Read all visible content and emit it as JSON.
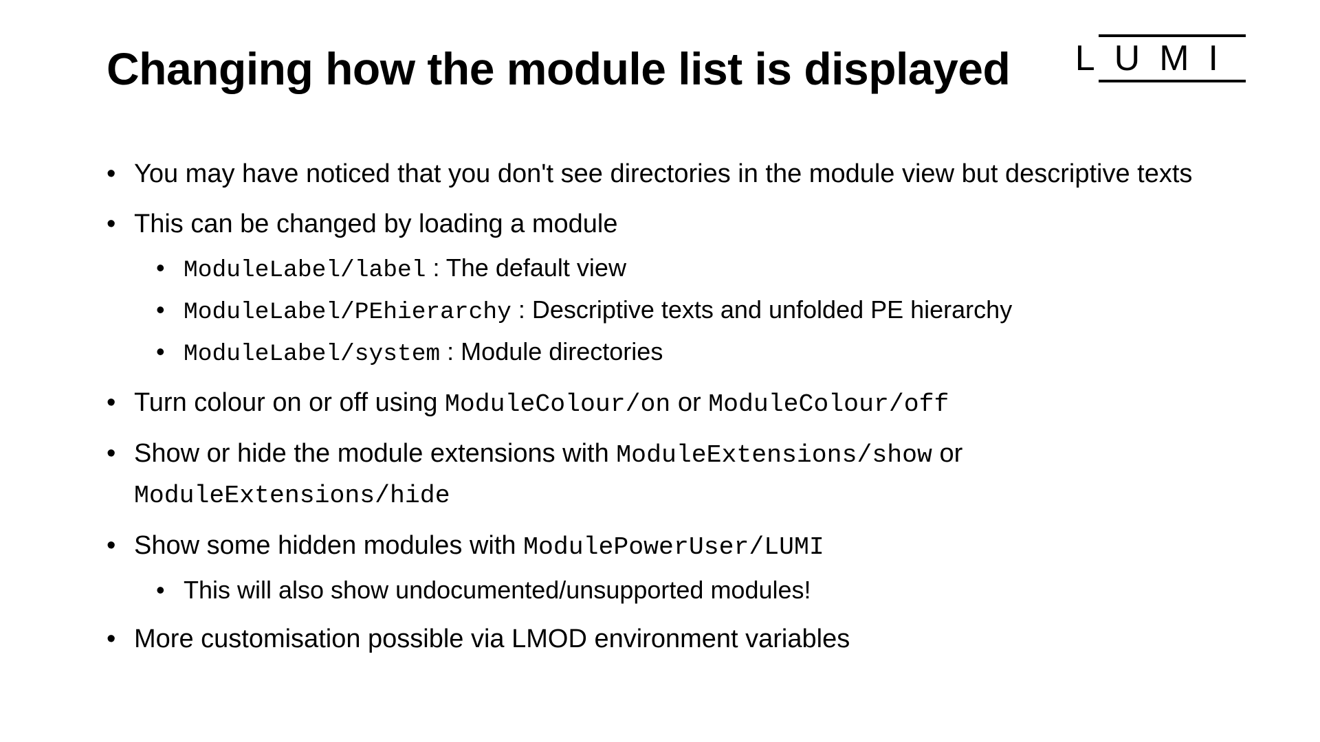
{
  "title": "Changing how the module list is displayed",
  "logo": "LUMI",
  "bullets": {
    "b1": "You may have noticed that you don't see directories in the module view but descriptive texts",
    "b2": "This can be changed by loading a module",
    "b2_1_code": "ModuleLabel/label",
    "b2_1_rest": " : The default view",
    "b2_2_code": "ModuleLabel/PEhierarchy",
    "b2_2_rest": " : Descriptive texts and unfolded PE hierarchy",
    "b2_3_code": "ModuleLabel/system",
    "b2_3_rest": " : Module directories",
    "b3_pre": "Turn colour on or off using ",
    "b3_code1": "ModuleColour/on",
    "b3_mid": " or ",
    "b3_code2": "ModuleColour/off",
    "b4_pre": "Show or hide the module extensions with ",
    "b4_code1": "ModuleExtensions/show",
    "b4_mid": " or ",
    "b4_code2": "ModuleExtensions/hide",
    "b5_pre": "Show some hidden modules with ",
    "b5_code": "ModulePowerUser/LUMI",
    "b5_1": "This will also show undocumented/unsupported modules!",
    "b6": "More customisation possible via LMOD environment variables"
  }
}
